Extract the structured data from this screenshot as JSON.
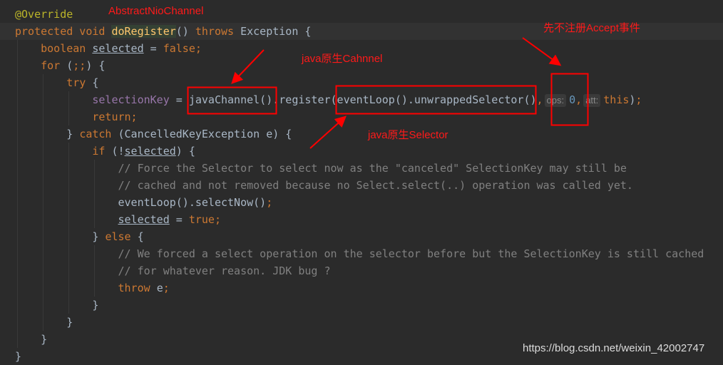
{
  "colors": {
    "background": "#2b2b2b",
    "keyword": "#cc7832",
    "method": "#ffc66d",
    "field": "#9876aa",
    "comment": "#808080",
    "annotation": "#bbb529",
    "number": "#6897bb",
    "annotation_red": "#ff0000"
  },
  "code": [
    [
      [
        "a",
        "@Override"
      ]
    ],
    [
      [
        "k",
        "protected void "
      ],
      [
        "mh",
        "doRegister"
      ],
      [
        "p",
        "() "
      ],
      [
        "k",
        "throws "
      ],
      [
        "p",
        "Exception {"
      ]
    ],
    [
      [
        "p",
        "    "
      ],
      [
        "k",
        "boolean "
      ],
      [
        "u",
        "selected"
      ],
      [
        "p",
        " = "
      ],
      [
        "k",
        "false;"
      ]
    ],
    [
      [
        "p",
        "    "
      ],
      [
        "k",
        "for "
      ],
      [
        "p",
        "("
      ],
      [
        "k",
        ";;"
      ],
      [
        "p",
        ") {"
      ]
    ],
    [
      [
        "p",
        "        "
      ],
      [
        "k",
        "try "
      ],
      [
        "p",
        "{"
      ]
    ],
    [
      [
        "p",
        "            "
      ],
      [
        "f",
        "selectionKey"
      ],
      [
        "p",
        " = javaChannel().register(eventLoop().unwrappedSelector()"
      ],
      [
        "k",
        ","
      ],
      [
        "h",
        "ops:"
      ],
      [
        "n",
        "0"
      ],
      [
        "k",
        ","
      ],
      [
        "h",
        "att:"
      ],
      [
        "k",
        "this"
      ],
      [
        "p",
        ")"
      ],
      [
        "k",
        ";"
      ]
    ],
    [
      [
        "p",
        "            "
      ],
      [
        "k",
        "return;"
      ]
    ],
    [
      [
        "p",
        "        } "
      ],
      [
        "k",
        "catch "
      ],
      [
        "p",
        "(CancelledKeyException e) {"
      ]
    ],
    [
      [
        "p",
        "            "
      ],
      [
        "k",
        "if "
      ],
      [
        "p",
        "(!"
      ],
      [
        "u",
        "selected"
      ],
      [
        "p",
        ") {"
      ]
    ],
    [
      [
        "p",
        "                "
      ],
      [
        "c",
        "// Force the Selector to select now as the \"canceled\" SelectionKey may still be"
      ]
    ],
    [
      [
        "p",
        "                "
      ],
      [
        "c",
        "// cached and not removed because no Select.select(..) operation was called yet."
      ]
    ],
    [
      [
        "p",
        "                eventLoop().selectNow()"
      ],
      [
        "k",
        ";"
      ]
    ],
    [
      [
        "p",
        "                "
      ],
      [
        "u",
        "selected"
      ],
      [
        "p",
        " = "
      ],
      [
        "k",
        "true;"
      ]
    ],
    [
      [
        "p",
        "            } "
      ],
      [
        "k",
        "else "
      ],
      [
        "p",
        "{"
      ]
    ],
    [
      [
        "p",
        "                "
      ],
      [
        "c",
        "// We forced a select operation on the selector before but the SelectionKey is still cached"
      ]
    ],
    [
      [
        "p",
        "                "
      ],
      [
        "c",
        "// for whatever reason. JDK bug ?"
      ]
    ],
    [
      [
        "p",
        "                "
      ],
      [
        "k",
        "throw "
      ],
      [
        "p",
        "e"
      ],
      [
        "k",
        ";"
      ]
    ],
    [
      [
        "p",
        "            }"
      ]
    ],
    [
      [
        "p",
        "        }"
      ]
    ],
    [
      [
        "p",
        "    }"
      ]
    ],
    [
      [
        "p",
        "}"
      ]
    ]
  ],
  "annotations": {
    "class_label": "AbstractNioChannel",
    "channel_label": "java原生Cahnnel",
    "selector_label": "java原生Selector",
    "ops_label": "先不注册Accept事件"
  },
  "watermark": "https://blog.csdn.net/weixin_42002747"
}
